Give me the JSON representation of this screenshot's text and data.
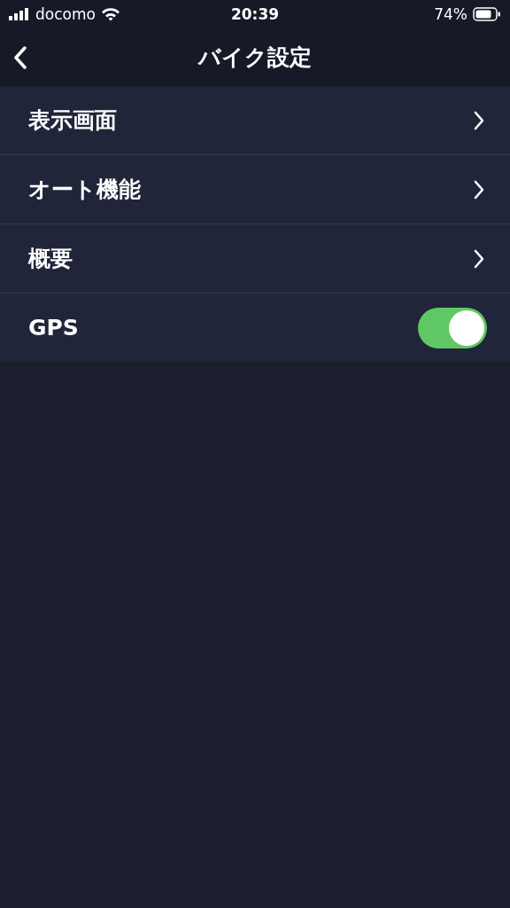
{
  "status_bar": {
    "carrier": "docomo",
    "time": "20:39",
    "battery": "74%"
  },
  "nav_bar": {
    "title": "バイク設定"
  },
  "settings": [
    {
      "kind": "link",
      "label": "表示画面"
    },
    {
      "kind": "link",
      "label": "オート機能"
    },
    {
      "kind": "link",
      "label": "概要"
    },
    {
      "kind": "toggle",
      "label": "GPS",
      "on": true
    }
  ]
}
